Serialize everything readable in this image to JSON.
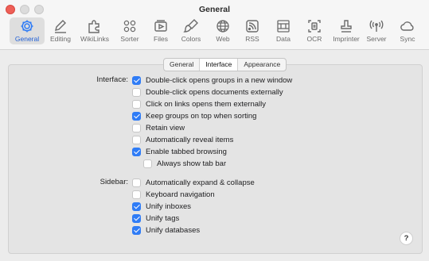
{
  "window": {
    "title": "General"
  },
  "toolbar": {
    "items": [
      {
        "label": "General",
        "icon": "gear-icon",
        "selected": true
      },
      {
        "label": "Editing",
        "icon": "pencil-icon",
        "selected": false
      },
      {
        "label": "WikiLinks",
        "icon": "puzzle-icon",
        "selected": false
      },
      {
        "label": "Sorter",
        "icon": "sorter-icon",
        "selected": false
      },
      {
        "label": "Files",
        "icon": "files-icon",
        "selected": false
      },
      {
        "label": "Colors",
        "icon": "paintbrush-icon",
        "selected": false
      },
      {
        "label": "Web",
        "icon": "globe-icon",
        "selected": false
      },
      {
        "label": "RSS",
        "icon": "rss-icon",
        "selected": false
      },
      {
        "label": "Data",
        "icon": "data-icon",
        "selected": false
      },
      {
        "label": "OCR",
        "icon": "ocr-icon",
        "selected": false
      },
      {
        "label": "Imprinter",
        "icon": "stamp-icon",
        "selected": false
      },
      {
        "label": "Server",
        "icon": "broadcast-icon",
        "selected": false
      },
      {
        "label": "Sync",
        "icon": "cloud-icon",
        "selected": false
      }
    ]
  },
  "tabs": [
    {
      "label": "General",
      "active": false
    },
    {
      "label": "Interface",
      "active": true
    },
    {
      "label": "Appearance",
      "active": false
    }
  ],
  "interface": {
    "section_label": "Interface:",
    "options": [
      {
        "label": "Double-click opens groups in a new window",
        "checked": true
      },
      {
        "label": "Double-click opens documents externally",
        "checked": false
      },
      {
        "label": "Click on links opens them externally",
        "checked": false
      },
      {
        "label": "Keep groups on top when sorting",
        "checked": true
      },
      {
        "label": "Retain view",
        "checked": false
      },
      {
        "label": "Automatically reveal items",
        "checked": false
      },
      {
        "label": "Enable tabbed browsing",
        "checked": true
      },
      {
        "label": "Always show tab bar",
        "checked": false
      }
    ]
  },
  "sidebar": {
    "section_label": "Sidebar:",
    "options": [
      {
        "label": "Automatically expand & collapse",
        "checked": false
      },
      {
        "label": "Keyboard navigation",
        "checked": false
      },
      {
        "label": "Unify inboxes",
        "checked": true
      },
      {
        "label": "Unify tags",
        "checked": true
      },
      {
        "label": "Unify databases",
        "checked": true
      }
    ]
  },
  "help": {
    "label": "?"
  },
  "colors": {
    "accent": "#2f7cf6",
    "selected_label": "#1f5fd6",
    "close": "#ee5f57"
  }
}
